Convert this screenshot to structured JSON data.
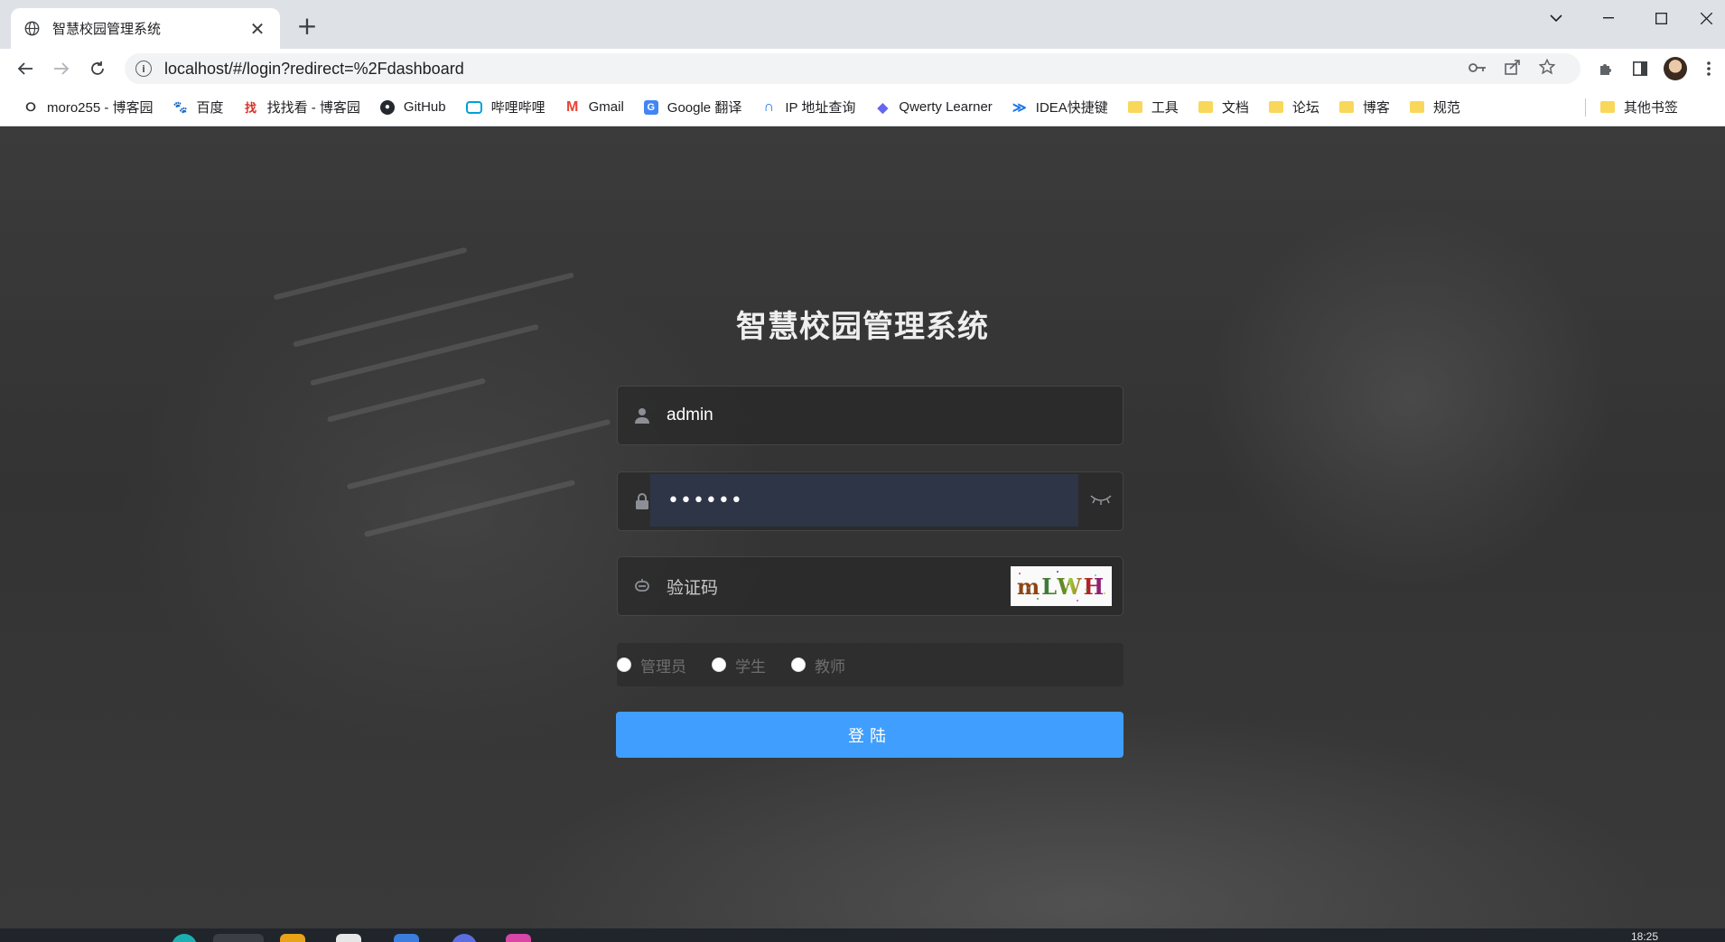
{
  "browser": {
    "tab_title": "智慧校园管理系统",
    "url": "localhost/#/login?redirect=%2Fdashboard",
    "bookmarks": [
      {
        "label": "moro255 - 博客园",
        "icon": "cnblogs-icon"
      },
      {
        "label": "百度",
        "icon": "baidu-icon"
      },
      {
        "label": "找找看 - 博客园",
        "icon": "zzk-icon"
      },
      {
        "label": "GitHub",
        "icon": "github-icon"
      },
      {
        "label": "哔哩哔哩",
        "icon": "bilibili-icon"
      },
      {
        "label": "Gmail",
        "icon": "gmail-icon"
      },
      {
        "label": "Google 翻译",
        "icon": "google-translate-icon"
      },
      {
        "label": "IP 地址查询",
        "icon": "ip-query-icon"
      },
      {
        "label": "Qwerty Learner",
        "icon": "qwerty-icon"
      },
      {
        "label": "IDEA快捷键",
        "icon": "idea-icon"
      },
      {
        "label": "工具",
        "icon": "folder-icon"
      },
      {
        "label": "文档",
        "icon": "folder-icon"
      },
      {
        "label": "论坛",
        "icon": "folder-icon"
      },
      {
        "label": "博客",
        "icon": "folder-icon"
      },
      {
        "label": "规范",
        "icon": "folder-icon"
      }
    ],
    "other_bookmarks": "其他书签"
  },
  "login": {
    "title": "智慧校园管理系统",
    "username_value": "admin",
    "password_value": "••••••",
    "captcha_placeholder": "验证码",
    "captcha_text": "mLWH",
    "roles": [
      "管理员",
      "学生",
      "教师"
    ],
    "submit_label": "登陆"
  },
  "taskbar": {
    "time": "18:25"
  },
  "colors": {
    "primary_button": "#409eff",
    "password_autofill_bg": "#2d3547"
  }
}
